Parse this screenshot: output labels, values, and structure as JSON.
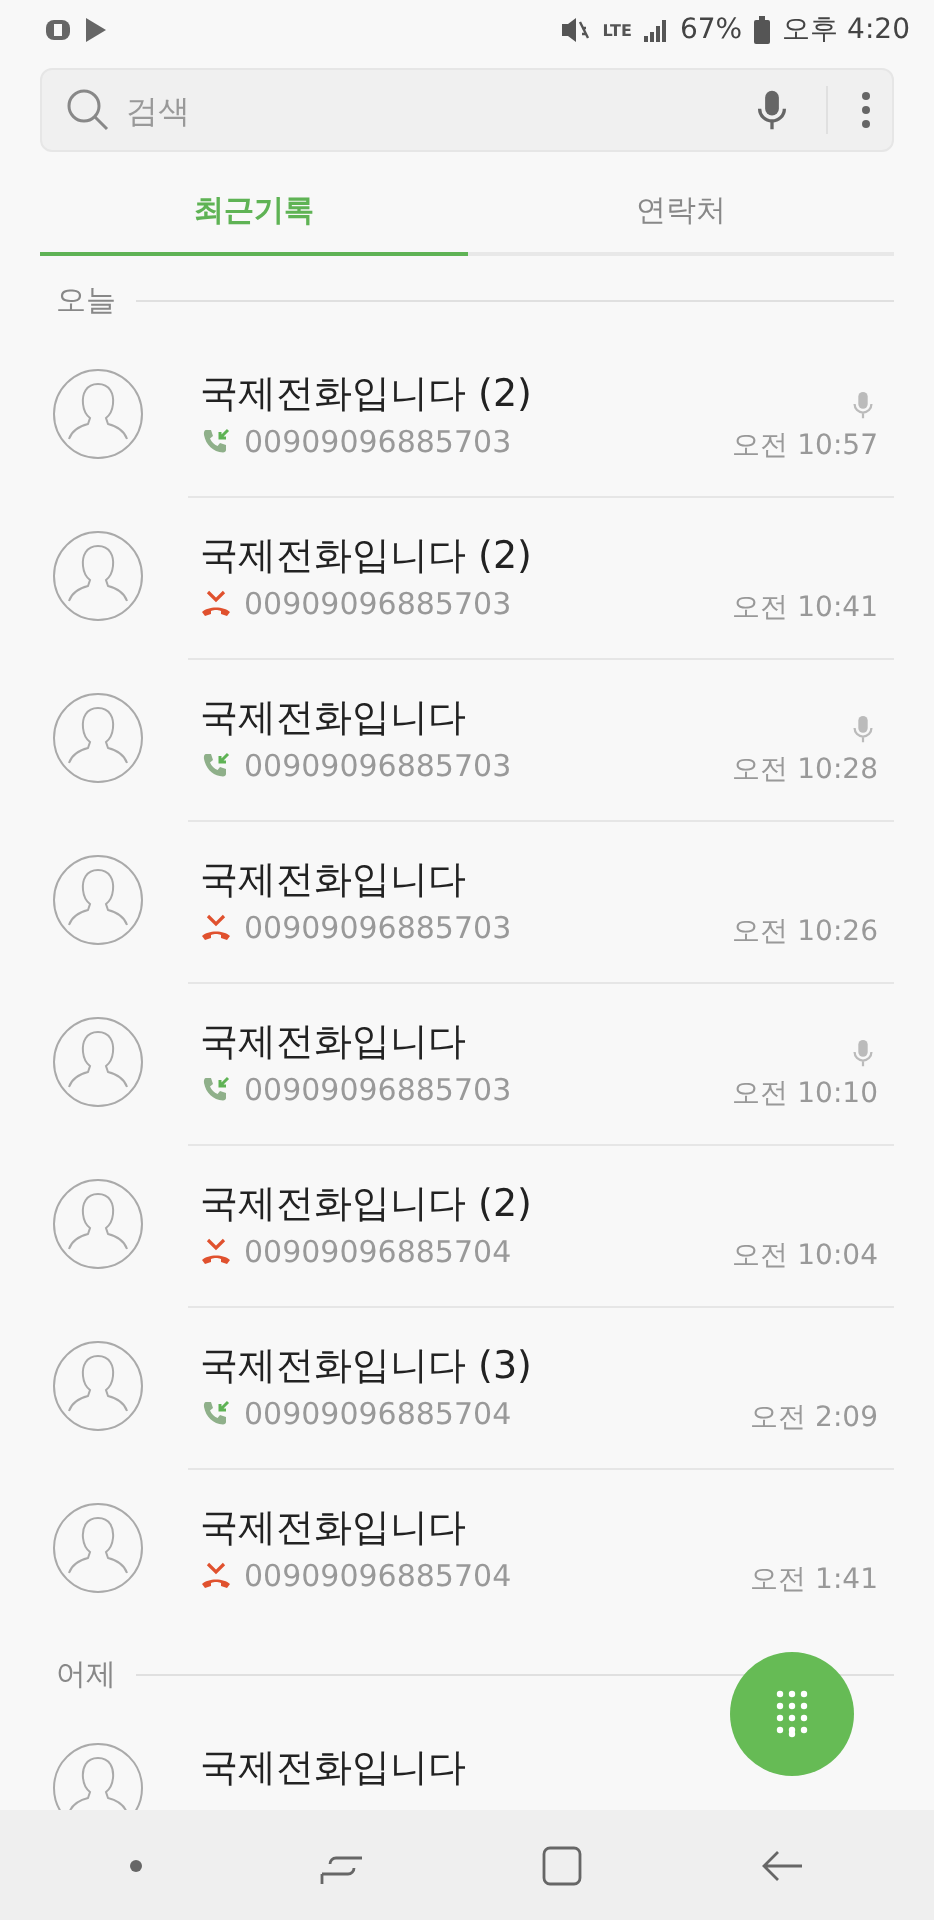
{
  "status_bar": {
    "network": "LTE",
    "battery": "67%",
    "time": "오후 4:20"
  },
  "search": {
    "placeholder": "검색"
  },
  "tabs": [
    {
      "label": "최근기록",
      "selected": true
    },
    {
      "label": "연락처",
      "selected": false
    }
  ],
  "sections": [
    {
      "title": "오늘",
      "calls": [
        {
          "name": "국제전화입니다 (2)",
          "number": "00909096885703",
          "time": "오전 10:57",
          "kind": "incoming",
          "recorded": true
        },
        {
          "name": "국제전화입니다 (2)",
          "number": "00909096885703",
          "time": "오전 10:41",
          "kind": "missed",
          "recorded": false
        },
        {
          "name": "국제전화입니다",
          "number": "00909096885703",
          "time": "오전 10:28",
          "kind": "incoming",
          "recorded": true
        },
        {
          "name": "국제전화입니다",
          "number": "00909096885703",
          "time": "오전 10:26",
          "kind": "missed",
          "recorded": false
        },
        {
          "name": "국제전화입니다",
          "number": "00909096885703",
          "time": "오전 10:10",
          "kind": "incoming",
          "recorded": true
        },
        {
          "name": "국제전화입니다 (2)",
          "number": "00909096885704",
          "time": "오전 10:04",
          "kind": "missed",
          "recorded": false
        },
        {
          "name": "국제전화입니다 (3)",
          "number": "00909096885704",
          "time": "오전 2:09",
          "kind": "incoming",
          "recorded": false
        },
        {
          "name": "국제전화입니다",
          "number": "00909096885704",
          "time": "오전 1:41",
          "kind": "missed",
          "recorded": false
        }
      ]
    },
    {
      "title": "어제",
      "calls": [
        {
          "name": "국제전화입니다"
        }
      ]
    }
  ]
}
